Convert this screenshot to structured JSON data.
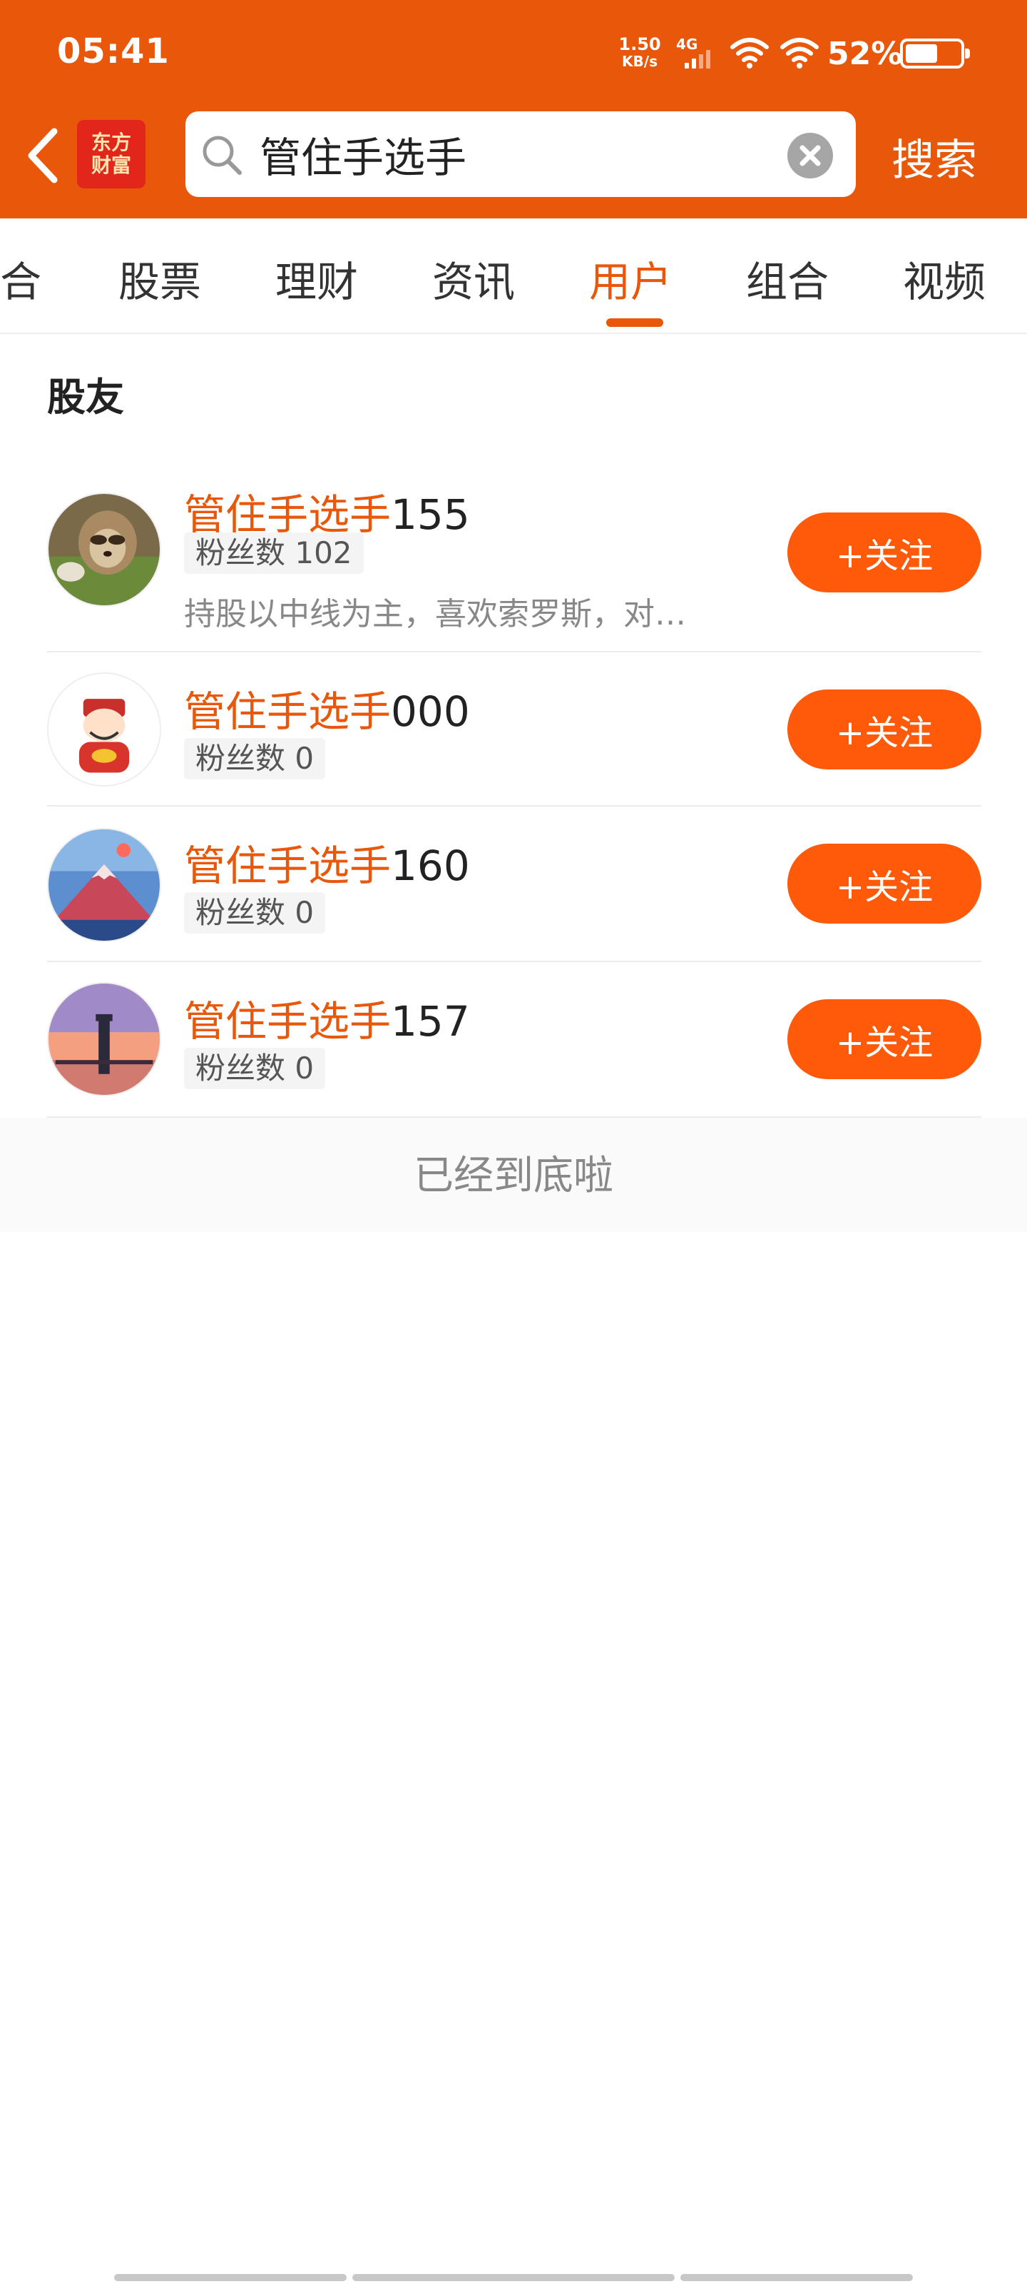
{
  "status_bar": {
    "time": "05:41",
    "net_speed_value": "1.50",
    "net_speed_unit": "KB/s",
    "network": "4G",
    "battery": "52%"
  },
  "header": {
    "logo_text": "东方财富",
    "search_value": "管住手选手",
    "search_button": "搜索"
  },
  "tabs": [
    {
      "label": "综合"
    },
    {
      "label": "股票"
    },
    {
      "label": "理财"
    },
    {
      "label": "资讯"
    },
    {
      "label": "用户",
      "active": true
    },
    {
      "label": "组合"
    },
    {
      "label": "视频"
    }
  ],
  "section_title": "股友",
  "users": [
    {
      "name_highlight": "管住手选手",
      "name_suffix": "155",
      "fans": "粉丝数 102",
      "bio": "持股以中线为主，喜欢索罗斯，对…",
      "follow_label": "+关注"
    },
    {
      "name_highlight": "管住手选手",
      "name_suffix": "000",
      "fans": "粉丝数 0",
      "follow_label": "+关注"
    },
    {
      "name_highlight": "管住手选手",
      "name_suffix": "160",
      "fans": "粉丝数 0",
      "follow_label": "+关注"
    },
    {
      "name_highlight": "管住手选手",
      "name_suffix": "157",
      "fans": "粉丝数 0",
      "follow_label": "+关注"
    }
  ],
  "end_text": "已经到底啦",
  "colors": {
    "brand": "#e8570a",
    "follow_button": "#ff5a0a"
  }
}
